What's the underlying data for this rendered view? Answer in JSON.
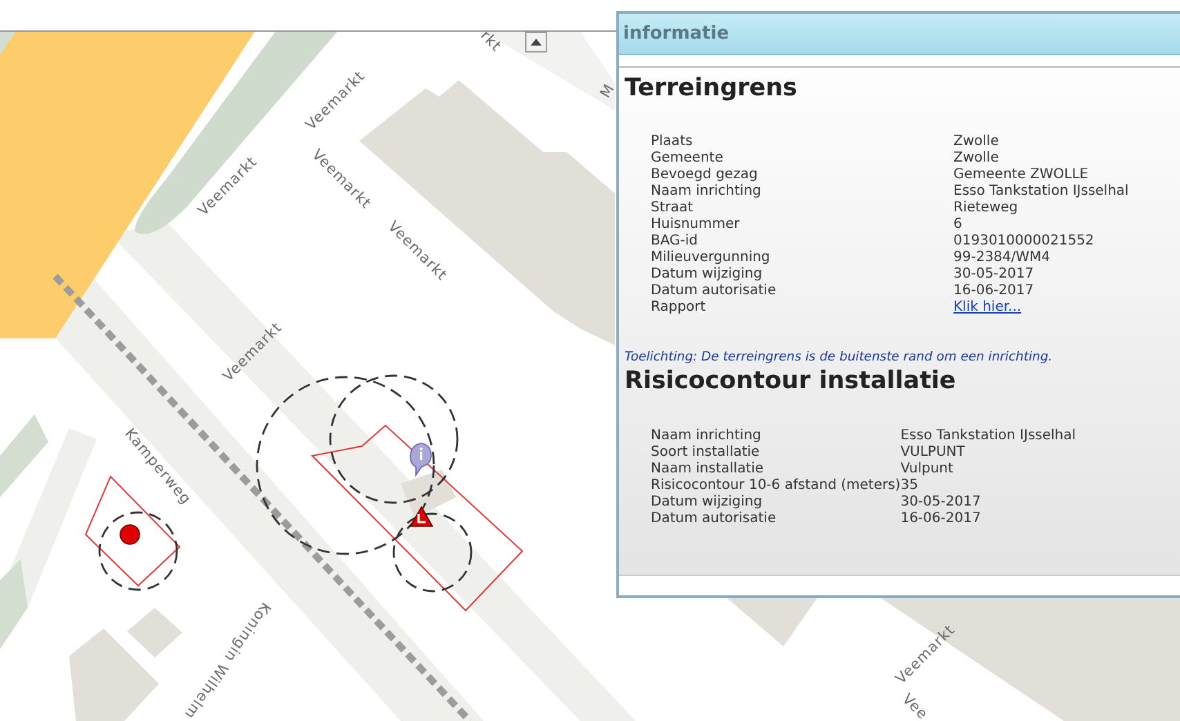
{
  "window": {
    "title": "informatie"
  },
  "sections": [
    {
      "title": "Terreingrens",
      "fields": [
        {
          "label": "Plaats",
          "value": "Zwolle",
          "kind": "text"
        },
        {
          "label": "Gemeente",
          "value": "Zwolle",
          "kind": "text"
        },
        {
          "label": "Bevoegd gezag",
          "value": "Gemeente ZWOLLE",
          "kind": "text"
        },
        {
          "label": "Naam inrichting",
          "value": "Esso Tankstation IJsselhal",
          "kind": "text"
        },
        {
          "label": "Straat",
          "value": "Rieteweg",
          "kind": "text"
        },
        {
          "label": "Huisnummer",
          "value": "6",
          "kind": "text"
        },
        {
          "label": "BAG-id",
          "value": "0193010000021552",
          "kind": "text"
        },
        {
          "label": "Milieuvergunning",
          "value": "99-2384/WM4",
          "kind": "text"
        },
        {
          "label": "Datum wijziging",
          "value": "30-05-2017",
          "kind": "text"
        },
        {
          "label": "Datum autorisatie",
          "value": "16-06-2017",
          "kind": "text"
        },
        {
          "label": "Rapport",
          "value": "Klik hier...",
          "kind": "link"
        }
      ],
      "note": "Toelichting: De terreingrens is de buitenste rand om een inrichting."
    },
    {
      "title": "Risicocontour installatie",
      "fields": [
        {
          "label": "Naam inrichting",
          "value": "Esso Tankstation IJsselhal",
          "kind": "text"
        },
        {
          "label": "Soort installatie",
          "value": "VULPUNT",
          "kind": "text"
        },
        {
          "label": "Naam installatie",
          "value": "Vulpunt",
          "kind": "text"
        },
        {
          "label": "Risicocontour 10-6 afstand (meters)",
          "value": "35",
          "kind": "text"
        },
        {
          "label": "Datum wijziging",
          "value": "30-05-2017",
          "kind": "text"
        },
        {
          "label": "Datum autorisatie",
          "value": "16-06-2017",
          "kind": "text"
        }
      ]
    }
  ],
  "map": {
    "street_labels": [
      "rkt",
      "Veemarkt",
      "Veemarkt",
      "Veemarkt",
      "Veemarkt",
      "Veemarkt",
      "M",
      "Kamperweg",
      "Koningin Wilhelm",
      "Veemarkt",
      "Vee"
    ]
  }
}
